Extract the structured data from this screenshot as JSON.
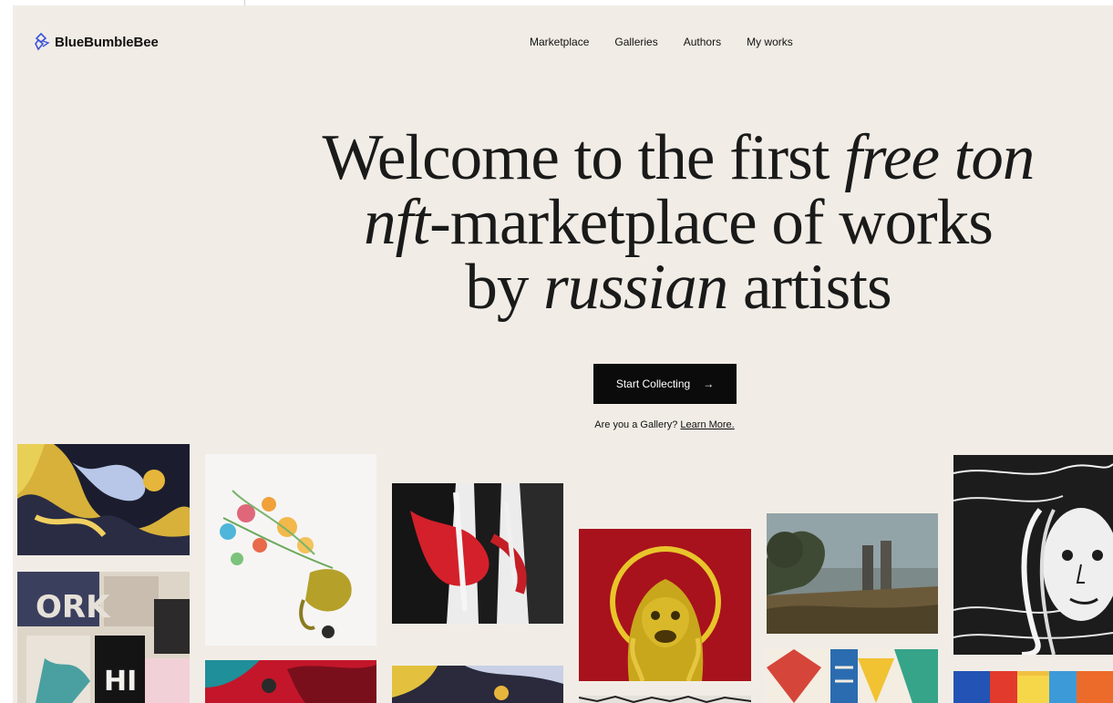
{
  "brand": {
    "name": "BlueBumbleBee",
    "logo_icon": "bee-logo-icon",
    "accent": "#3d55d6"
  },
  "nav": {
    "items": [
      {
        "label": "Marketplace"
      },
      {
        "label": "Galleries"
      },
      {
        "label": "Authors"
      },
      {
        "label": "My works"
      }
    ]
  },
  "hero": {
    "line1_plain": "Welcome to the first ",
    "line1_italic": "free ton",
    "line2_italic": "nft",
    "line2_plain": "-marketplace of works",
    "line3_plain_a": "by ",
    "line3_italic": "russian",
    "line3_plain_b": " artists"
  },
  "cta": {
    "label": "Start Collecting",
    "arrow": "→"
  },
  "gallery_prompt": {
    "question": "Are you a Gallery? ",
    "link": "Learn More."
  },
  "colors": {
    "page_bg": "#f1ede6",
    "button_bg": "#0b0b0b",
    "text": "#111111"
  },
  "artworks": [
    {
      "name": "artwork-fluid-yellow-blue"
    },
    {
      "name": "artwork-street-posters"
    },
    {
      "name": "artwork-floral-vase"
    },
    {
      "name": "artwork-red-teal-abstract"
    },
    {
      "name": "artwork-red-black-brush"
    },
    {
      "name": "artwork-yellow-fluid-lower"
    },
    {
      "name": "artwork-golden-lion-statue"
    },
    {
      "name": "artwork-bw-strip"
    },
    {
      "name": "artwork-landscape-painting"
    },
    {
      "name": "artwork-geometric-colors"
    },
    {
      "name": "artwork-woman-engraving"
    },
    {
      "name": "artwork-colorful-strokes"
    }
  ]
}
